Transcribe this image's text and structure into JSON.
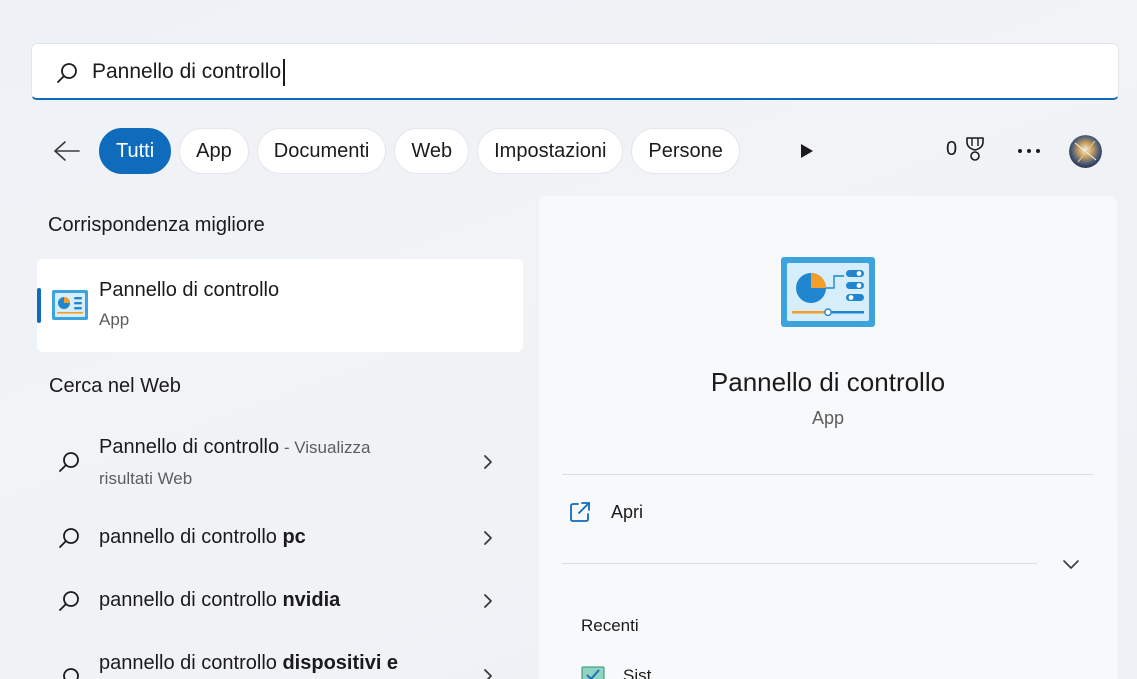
{
  "search": {
    "value": "Pannello di controllo"
  },
  "filters": [
    {
      "label": "Tutti",
      "active": true
    },
    {
      "label": "App"
    },
    {
      "label": "Documenti"
    },
    {
      "label": "Web"
    },
    {
      "label": "Impostazioni"
    },
    {
      "label": "Persone"
    }
  ],
  "toolbar": {
    "rewards_points": "0"
  },
  "best_match": {
    "section_title": "Corrispondenza migliore",
    "name": "Pannello di controllo",
    "type": "App"
  },
  "web": {
    "section_title": "Cerca nel Web",
    "results": [
      {
        "text": "Pannello di controllo",
        "suffix": " - Visualizza risultati Web"
      },
      {
        "text": "pannello di controllo ",
        "bold": "pc"
      },
      {
        "text": "pannello di controllo ",
        "bold": "nvidia"
      },
      {
        "text": "pannello di controllo ",
        "bold": "dispositivi e"
      }
    ]
  },
  "preview": {
    "name": "Pannello di controllo",
    "type": "App",
    "open_label": "Apri",
    "recent_title": "Recenti",
    "recent_item": "Sist"
  },
  "colors": {
    "accent": "#0f6cbd"
  },
  "icons": [
    "search-icon",
    "back-arrow-icon",
    "play-icon",
    "trophy-icon",
    "more-icon",
    "control-panel-icon",
    "chevron-right-icon",
    "open-external-icon",
    "chevron-down-icon"
  ]
}
